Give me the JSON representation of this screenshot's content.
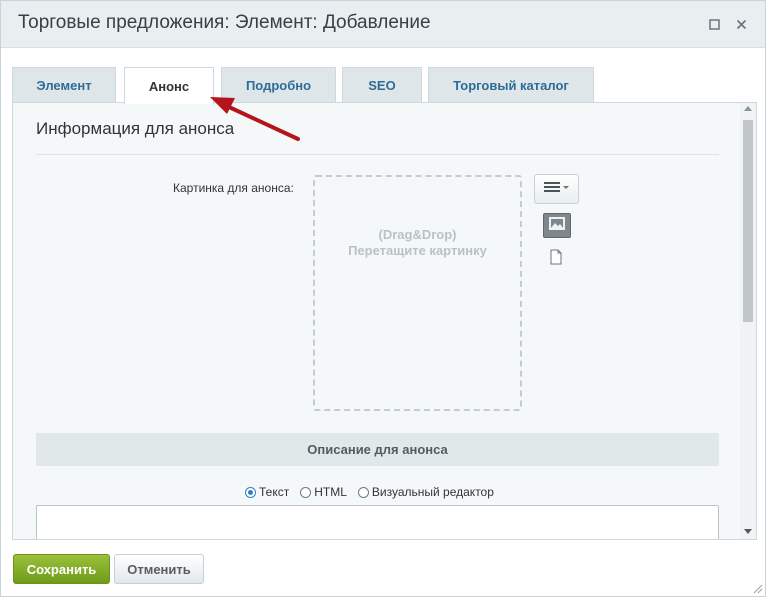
{
  "window": {
    "title": "Торговые предложения: Элемент: Добавление"
  },
  "tabs": [
    {
      "label": "Элемент",
      "active": false
    },
    {
      "label": "Анонс",
      "active": true
    },
    {
      "label": "Подробно",
      "active": false
    },
    {
      "label": "SEO",
      "active": false
    },
    {
      "label": "Торговый каталог",
      "active": false
    }
  ],
  "section": {
    "title": "Информация для анонса",
    "picture_label": "Картинка для анонса:",
    "dropzone_line1": "(Drag&Drop)",
    "dropzone_line2": "Перетащите картинку",
    "description_header": "Описание для анонса"
  },
  "editor_modes": [
    {
      "label": "Текст",
      "checked": true
    },
    {
      "label": "HTML",
      "checked": false
    },
    {
      "label": "Визуальный редактор",
      "checked": false
    }
  ],
  "description_text": {
    "value": ""
  },
  "footer": {
    "save_label": "Сохранить",
    "cancel_label": "Отменить"
  },
  "colors": {
    "accent_green": "#7ea52a",
    "tab_text": "#2e6c95",
    "annotation_arrow": "#b3151b"
  },
  "icons": [
    "maximize-icon",
    "close-icon",
    "menu-icon",
    "image-icon",
    "file-icon",
    "resize-handle-icon"
  ]
}
